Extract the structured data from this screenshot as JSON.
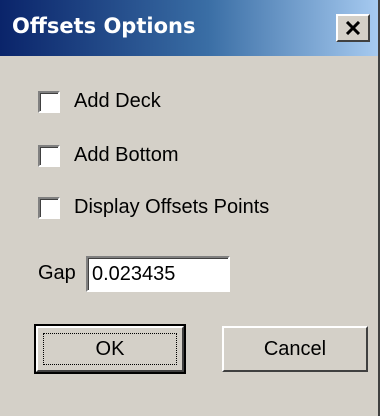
{
  "window": {
    "title": "Offsets Options",
    "close_icon": "close-icon"
  },
  "options": [
    {
      "label": "Add Deck",
      "checked": false
    },
    {
      "label": "Add Bottom",
      "checked": false
    },
    {
      "label": "Display Offsets Points",
      "checked": false
    }
  ],
  "gap": {
    "label": "Gap",
    "value": "0.023435"
  },
  "buttons": {
    "ok_label": "OK",
    "cancel_label": "Cancel"
  },
  "colors": {
    "title_gradient_start": "#0a246a",
    "title_gradient_end": "#a6caf0",
    "dialog_face": "#d4d0c8"
  }
}
